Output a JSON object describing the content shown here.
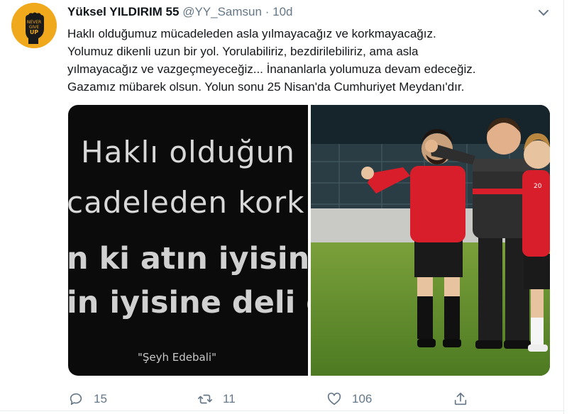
{
  "tweet": {
    "author_name": "Yüksel YILDIRIM 55",
    "handle": "@YY_Samsun",
    "separator": "·",
    "time": "10d",
    "avatar_text": [
      "NEVER",
      "GIVE",
      "UP"
    ],
    "text_lines": [
      "Haklı olduğumuz mücadeleden asla yılmayacağız ve korkmayacağız.",
      "Yolumuz dikenli uzun bir yol. Yorulabiliriz, bezdirilebiliriz, ama asla",
      "yılmayacağız ve vazgeçmeyeceğiz... İnananlarla yolumuza devam edeceğiz.",
      "Gazamız mübarek olsun. Yolun sonu 25 Nisan'da Cumhuriyet Meydanı'dır."
    ]
  },
  "media": {
    "quote_lines": [
      "Haklı olduğun",
      "cadeleden kork",
      "n ki atın iyisine",
      "in iyisine deli d"
    ],
    "quote_author": "\"Şeyh Edebali\"",
    "photo_badge": "20"
  },
  "actions": {
    "reply_icon": "reply-icon",
    "reply_count": "15",
    "retweet_icon": "retweet-icon",
    "retweet_count": "11",
    "like_icon": "heart-icon",
    "like_count": "106",
    "share_icon": "share-icon"
  },
  "colors": {
    "avatar_bg": "#f0a81c",
    "secondary_text": "#657786",
    "jersey_red": "#d91e2b",
    "pitch_green": "#5f8a2e"
  }
}
